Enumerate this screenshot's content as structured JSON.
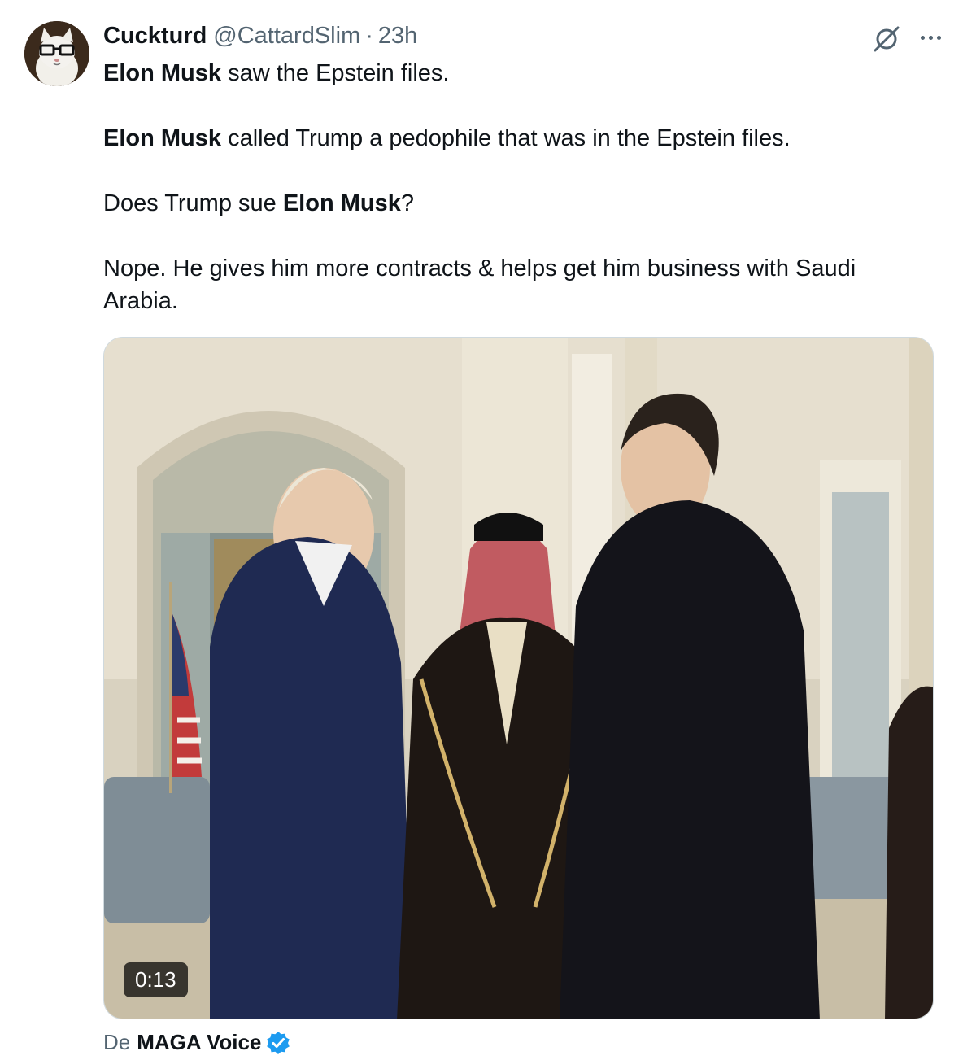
{
  "tweet": {
    "author": {
      "display_name": "Cuckturd",
      "handle": "@CattardSlim",
      "separator": "·",
      "time": "23h",
      "avatar_icon": "cat-with-glasses-avatar"
    },
    "actions": {
      "grok_icon": "grok-icon",
      "more_icon": "more-options-icon"
    },
    "text": {
      "p1_bold": "Elon Musk",
      "p1_rest": " saw the Epstein files.",
      "p2_bold": "Elon Musk",
      "p2_rest": " called Trump a pedophile that was in the Epstein files.",
      "p3_pre": "Does Trump sue ",
      "p3_bold": "Elon Musk",
      "p3_post": "?",
      "p4": "Nope. He gives him more contracts & helps get him business with Saudi Arabia."
    },
    "media": {
      "type": "video",
      "duration": "0:13"
    },
    "source": {
      "prefix": "De",
      "account": "MAGA Voice",
      "verified_icon": "verified-badge-icon",
      "verified_color": "#1d9bf0"
    }
  }
}
